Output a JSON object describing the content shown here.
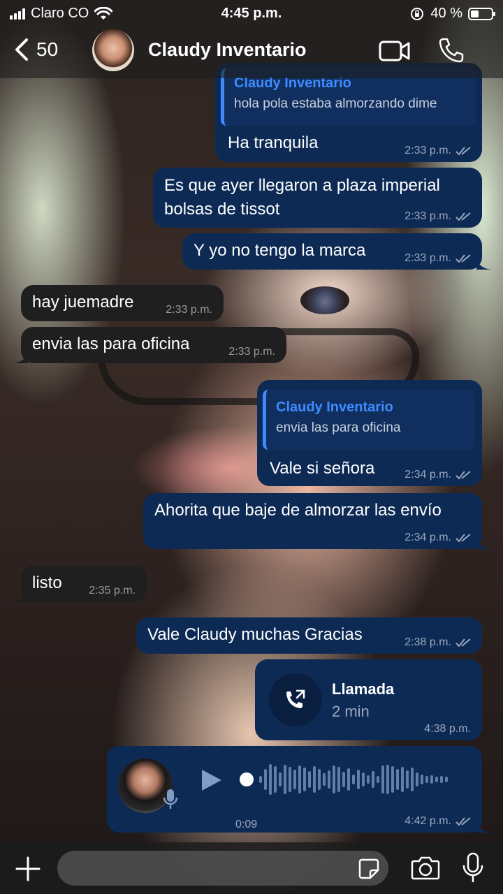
{
  "status_bar": {
    "carrier": "Claro CO",
    "time": "4:45 p.m.",
    "battery": "40 %",
    "battery_level": 0.4
  },
  "header": {
    "back_count": "50",
    "contact_name": "Claudy Inventario"
  },
  "messages": [
    {
      "quote_name": "Claudy Inventario",
      "quote_text": "hola pola estaba almorzando dime",
      "text": "Ha tranquila",
      "time": "2:33 p.m."
    },
    {
      "text_line1": "Es que ayer llegaron a plaza imperial",
      "text_line2": "bolsas de tissot",
      "time": "2:33 p.m."
    },
    {
      "text": "Y yo no tengo la marca",
      "time": "2:33 p.m."
    },
    {
      "text": "hay juemadre",
      "time": "2:33 p.m."
    },
    {
      "text": "envia las para oficina",
      "time": "2:33 p.m."
    },
    {
      "quote_name": "Claudy Inventario",
      "quote_text": "envia las para oficina",
      "text": "Vale si señora",
      "time": "2:34 p.m."
    },
    {
      "text": "Ahorita que baje de almorzar las envío",
      "time": "2:34 p.m."
    },
    {
      "text": "listo",
      "time": "2:35 p.m."
    },
    {
      "text": "Vale Claudy muchas Gracias",
      "time": "2:38 p.m."
    },
    {
      "title": "Llamada",
      "duration": "2 min",
      "time": "4:38 p.m."
    },
    {
      "duration": "0:09",
      "time": "4:42 p.m.",
      "progress": 0
    }
  ],
  "icons": {
    "back": "chevron-left-icon",
    "video": "video-camera-icon",
    "phone": "phone-icon",
    "read": "double-check-icon",
    "outgoing_call": "outgoing-call-icon",
    "play": "play-icon",
    "mic": "microphone-icon",
    "plus": "plus-icon",
    "sticker": "sticker-icon",
    "camera": "camera-icon"
  },
  "colors": {
    "outgoing": "#0d2a55",
    "incoming": "#1f1f1f",
    "quote_accent": "#3e8bff"
  }
}
